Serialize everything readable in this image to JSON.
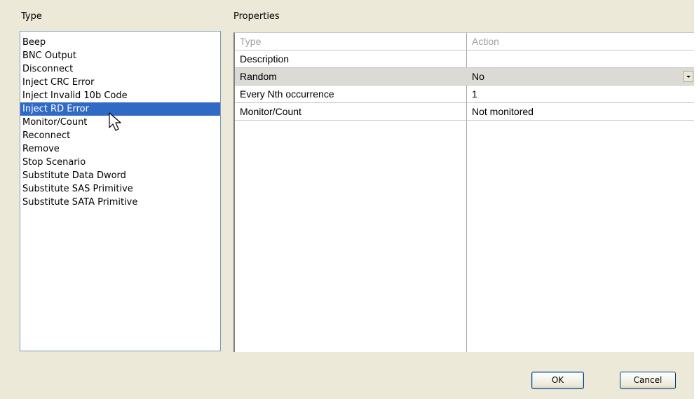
{
  "type_panel": {
    "label": "Type",
    "items": [
      {
        "label": "Beep"
      },
      {
        "label": "BNC Output"
      },
      {
        "label": "Disconnect"
      },
      {
        "label": "Inject CRC Error"
      },
      {
        "label": "Inject Invalid 10b Code"
      },
      {
        "label": "Inject RD Error"
      },
      {
        "label": "Monitor/Count"
      },
      {
        "label": "Reconnect"
      },
      {
        "label": "Remove"
      },
      {
        "label": "Stop Scenario"
      },
      {
        "label": "Substitute Data Dword"
      },
      {
        "label": "Substitute SAS Primitive"
      },
      {
        "label": "Substitute SATA Primitive"
      }
    ],
    "selected_item": "Inject RD Error"
  },
  "properties_panel": {
    "label": "Properties",
    "rows": [
      {
        "name": "Type",
        "value": "Action"
      },
      {
        "name": "Description",
        "value": ""
      },
      {
        "name": "Random",
        "value": "No"
      },
      {
        "name": "Every Nth occurrence",
        "value": "1"
      },
      {
        "name": "Monitor/Count",
        "value": "Not monitored"
      }
    ]
  },
  "buttons": {
    "ok_label": "OK",
    "cancel_label": "Cancel"
  },
  "colors": {
    "dialog_background": "#ece9d8",
    "selection": "#316ac5",
    "list_border": "#7f9db9"
  },
  "icons": {
    "cursor": "mouse-pointer-icon",
    "dropdown": "chevron-down-icon"
  }
}
